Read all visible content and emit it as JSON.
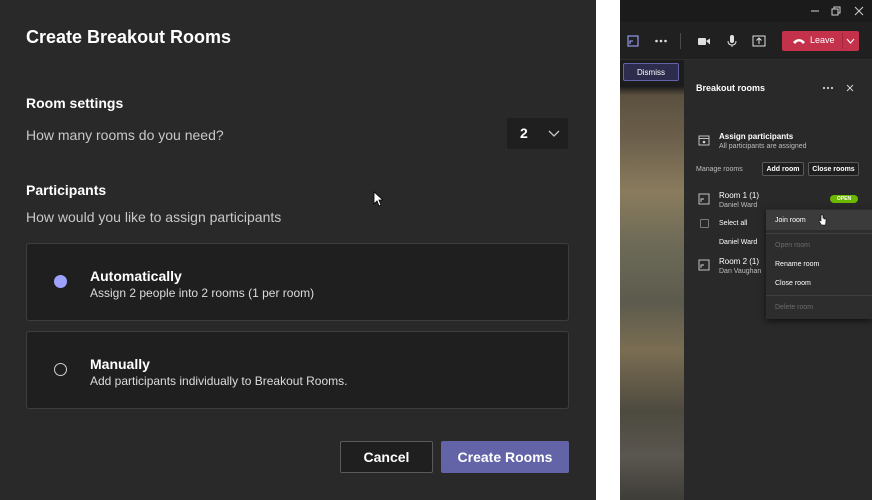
{
  "dialog": {
    "title": "Create Breakout Rooms",
    "room_settings_heading": "Room settings",
    "rooms_question": "How many rooms do you need?",
    "room_count": "2",
    "participants_heading": "Participants",
    "participants_question": "How would you like to assign participants",
    "options": [
      {
        "title": "Automatically",
        "desc": "Assign 2 people into 2 rooms (1 per room)",
        "selected": true
      },
      {
        "title": "Manually",
        "desc": "Add participants individually to Breakout Rooms.",
        "selected": false
      }
    ],
    "cancel_label": "Cancel",
    "create_label": "Create Rooms"
  },
  "meeting": {
    "leave_label": "Leave",
    "dismiss_label": "Dismiss"
  },
  "panel": {
    "title": "Breakout rooms",
    "assign_title": "Assign participants",
    "assign_status": "All participants are assigned",
    "manage_label": "Manage rooms",
    "add_room_label": "Add room",
    "close_rooms_label": "Close rooms",
    "rooms": [
      {
        "name": "Room 1 (1)",
        "member": "Daniel Ward",
        "status": "OPEN"
      },
      {
        "name": "Room 2 (1)",
        "member": "Dan Vaughan"
      }
    ],
    "select_all_label": "Select all",
    "member_row": "Daniel Ward"
  },
  "context_menu": {
    "items": [
      "Join room",
      "Open room",
      "Rename room",
      "Close room",
      "Delete room"
    ]
  },
  "colors": {
    "accent": "#6264a7",
    "radio_selected": "#9ea2ff",
    "leave": "#c4314b",
    "open_badge": "#6bb700"
  }
}
